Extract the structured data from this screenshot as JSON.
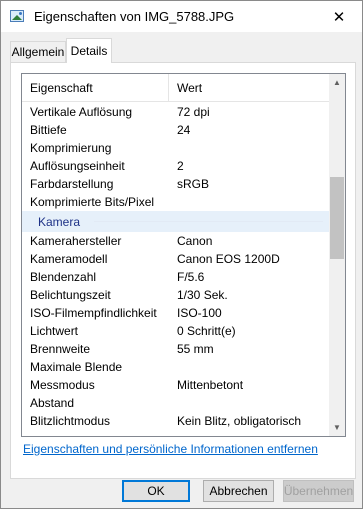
{
  "window": {
    "title": "Eigenschaften von IMG_5788.JPG",
    "close_glyph": "✕"
  },
  "tabs": [
    {
      "label": "Allgemein",
      "active": false
    },
    {
      "label": "Details",
      "active": true
    }
  ],
  "table": {
    "headers": {
      "property": "Eigenschaft",
      "value": "Wert"
    },
    "rows_before_group": [
      {
        "key": "Vertikale Auflösung",
        "value": "72 dpi"
      },
      {
        "key": "Bittiefe",
        "value": "24"
      },
      {
        "key": "Komprimierung",
        "value": ""
      },
      {
        "key": "Auflösungseinheit",
        "value": "2"
      },
      {
        "key": "Farbdarstellung",
        "value": "sRGB"
      },
      {
        "key": "Komprimierte Bits/Pixel",
        "value": ""
      }
    ],
    "group_label": "Kamera",
    "rows_after_group": [
      {
        "key": "Kamerahersteller",
        "value": "Canon"
      },
      {
        "key": "Kameramodell",
        "value": "Canon EOS 1200D"
      },
      {
        "key": "Blendenzahl",
        "value": "F/5.6"
      },
      {
        "key": "Belichtungszeit",
        "value": "1/30 Sek."
      },
      {
        "key": "ISO-Filmempfindlichkeit",
        "value": "ISO-100"
      },
      {
        "key": "Lichtwert",
        "value": "0 Schritt(e)"
      },
      {
        "key": "Brennweite",
        "value": "55 mm"
      },
      {
        "key": "Maximale Blende",
        "value": ""
      },
      {
        "key": "Messmodus",
        "value": "Mittenbetont"
      },
      {
        "key": "Abstand",
        "value": ""
      },
      {
        "key": "Blitzlichtmodus",
        "value": "Kein Blitz, obligatorisch"
      }
    ]
  },
  "link_label": "Eigenschaften und persönliche Informationen entfernen",
  "buttons": {
    "ok": "OK",
    "cancel": "Abbrechen",
    "apply": "Übernehmen"
  },
  "icons": {
    "title": "image-file-icon",
    "scroll_up": "▲",
    "scroll_down": "▼"
  },
  "colors": {
    "accent": "#0078d7",
    "link": "#0066cc",
    "group_text": "#1e3287"
  }
}
